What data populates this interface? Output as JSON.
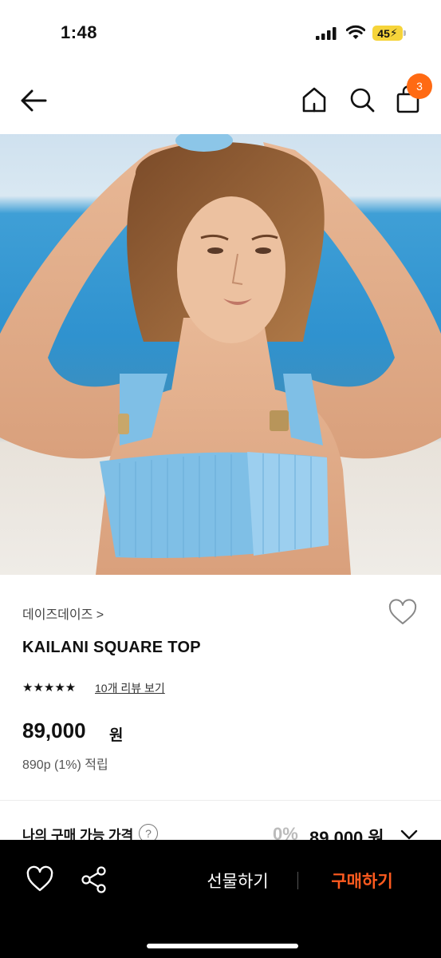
{
  "status_bar": {
    "time": "1:48",
    "battery": "45"
  },
  "header": {
    "cart_count": "3"
  },
  "product": {
    "brand": "데이즈데이즈 >",
    "name": "KAILANI SQUARE TOP",
    "stars": "★★★★★",
    "rating": 5,
    "review_link": "10개 리뷰 보기",
    "price": "89,000",
    "currency": "원",
    "points": "890p (1%) 적립"
  },
  "my_price": {
    "label": "나의 구매 가능 가격",
    "help": "?",
    "discount": "0%",
    "value": "89,000 원"
  },
  "bottom_bar": {
    "gift_label": "선물하기",
    "buy_label": "구매하기"
  },
  "colors": {
    "accent": "#ff5b1f",
    "badge": "#ff6a13",
    "bar_background": "#000000",
    "bikini_blue": "#7fbfe6"
  },
  "icons": [
    "back-arrow-icon",
    "home-icon",
    "search-icon",
    "shopping-bag-icon",
    "heart-icon",
    "share-icon",
    "chevron-down-icon",
    "help-icon"
  ]
}
